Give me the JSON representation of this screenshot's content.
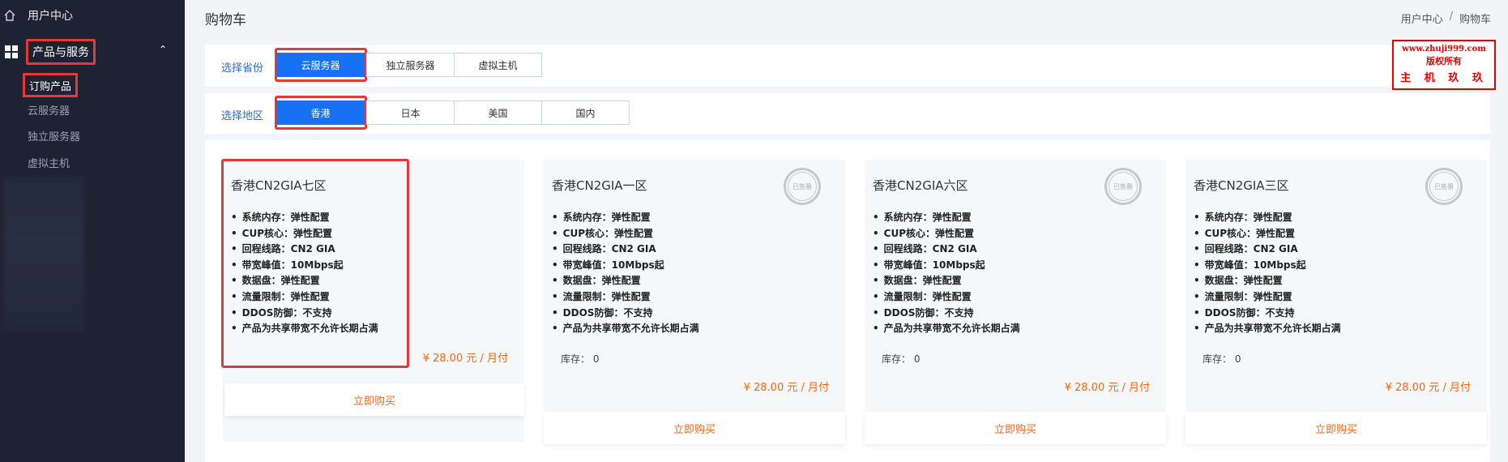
{
  "sidebar": {
    "home_label": "用户中心",
    "products_label": "产品与服务",
    "order_label": "订购产品",
    "sub_items": [
      "云服务器",
      "独立服务器",
      "虚拟主机"
    ]
  },
  "header": {
    "title": "购物车",
    "breadcrumb": [
      "用户中心",
      "/",
      "购物车"
    ]
  },
  "filters": {
    "province": {
      "label": "选择省份",
      "options": [
        "云服务器",
        "独立服务器",
        "虚拟主机"
      ],
      "selected": "云服务器"
    },
    "region": {
      "label": "选择地区",
      "options": [
        "香港",
        "日本",
        "美国",
        "国内"
      ],
      "selected": "香港"
    }
  },
  "watermark": {
    "line1": "www.zhuji999.com",
    "line2": "版权所有",
    "line3": "主 机 玖 玖"
  },
  "products": [
    {
      "name": "香港CN2GIA七区",
      "specs": [
        "系统内存：弹性配置",
        "CUP核心：弹性配置",
        "回程线路：CN2 GIA",
        "带宽峰值：10Mbps起",
        "数据盘：弹性配置",
        "流量限制：弹性配置",
        "DDOS防御：不支持",
        "产品为共享带宽不允许长期占满"
      ],
      "price": "¥ 28.00 元 / 月付",
      "buy_label": "立即购买",
      "sold_out": false
    },
    {
      "name": "香港CN2GIA一区",
      "specs": [
        "系统内存：弹性配置",
        "CUP核心：弹性配置",
        "回程线路：CN2 GIA",
        "带宽峰值：10Mbps起",
        "数据盘：弹性配置",
        "流量限制：弹性配置",
        "DDOS防御：不支持",
        "产品为共享带宽不允许长期占满"
      ],
      "stock": "库存： 0",
      "price": "¥ 28.00 元 / 月付",
      "buy_label": "立即购买",
      "sold_out": true,
      "sold_out_label": "已售罄"
    },
    {
      "name": "香港CN2GIA六区",
      "specs": [
        "系统内存：弹性配置",
        "CUP核心：弹性配置",
        "回程线路：CN2 GIA",
        "带宽峰值：10Mbps起",
        "数据盘：弹性配置",
        "流量限制：弹性配置",
        "DDOS防御：不支持",
        "产品为共享带宽不允许长期占满"
      ],
      "stock": "库存： 0",
      "price": "¥ 28.00 元 / 月付",
      "buy_label": "立即购买",
      "sold_out": true,
      "sold_out_label": "已售罄"
    },
    {
      "name": "香港CN2GIA三区",
      "specs": [
        "系统内存：弹性配置",
        "CUP核心：弹性配置",
        "回程线路：CN2 GIA",
        "带宽峰值：10Mbps起",
        "数据盘：弹性配置",
        "流量限制：弹性配置",
        "DDOS防御：不支持",
        "产品为共享带宽不允许长期占满"
      ],
      "stock": "库存： 0",
      "price": "¥ 28.00 元 / 月付",
      "buy_label": "立即购买",
      "sold_out": true,
      "sold_out_label": "已售罄"
    }
  ],
  "colors": {
    "accent": "#1671f5",
    "price": "#f06a1c",
    "highlight": "#e03a3a",
    "sidebar_bg": "#1d2332"
  }
}
